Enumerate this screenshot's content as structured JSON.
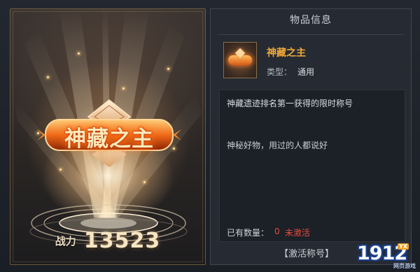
{
  "display": {
    "title_text": "神藏之主",
    "power_label": "战力",
    "power_value": "13523"
  },
  "info_panel": {
    "header": "物品信息",
    "item": {
      "name": "神藏之主",
      "type_label": "类型：",
      "type_value": "通用"
    },
    "description": {
      "line1": "神藏遗迹排名第一获得的限时称号",
      "line2": "神秘好物，用过的人都说好"
    },
    "count": {
      "label": "已有数量：",
      "value": "0",
      "status": "未激活"
    },
    "activate_label": "【激活称号】"
  },
  "watermark": {
    "text": "1912",
    "badge": "YX",
    "sub": "网页游戏"
  },
  "colors": {
    "item_name": "#f2a93a",
    "inactive": "#e64a3d",
    "frame_gold": "#6b5a3e"
  }
}
